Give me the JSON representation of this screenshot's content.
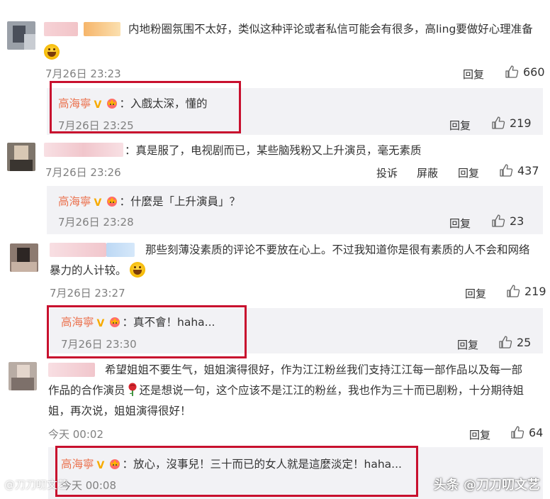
{
  "colors": {
    "reply_author": "#eb7350",
    "highlight_box": "#c8102e",
    "reply_background": "#f2f2f5",
    "timestamp": "#808080"
  },
  "comments": [
    {
      "text_line1": "内地粉圈氛围不太好，类似这种评论或者私信可能会有很多，高ling要做好心理准备",
      "timestamp": "7月26日 23:23",
      "reply_label": "回复",
      "likes": "660",
      "reply": {
        "author": "高海寧",
        "separator": "：",
        "text": "入戲太深，懂的",
        "timestamp": "7月26日 23:25",
        "reply_label": "回复",
        "likes": "219"
      }
    },
    {
      "text_line1": "：真是服了，电视剧而已，某些脑残粉又上升演员，毫无素质",
      "timestamp": "7月26日 23:26",
      "report_label": "投诉",
      "block_label": "屏蔽",
      "reply_label": "回复",
      "likes": "437",
      "reply": {
        "author": "高海寧",
        "separator": "：",
        "text": "什麼是「上升演員」？",
        "timestamp": "7月26日 23:28",
        "reply_label": "回复",
        "likes": "23"
      }
    },
    {
      "text_line1": "那些刻薄没素质的评论不要放在心上。不过我知道你是很有素质的人不会和网络",
      "text_line2": "暴力的人计较。",
      "timestamp": "7月26日 23:27",
      "reply_label": "回复",
      "likes": "219",
      "reply": {
        "author": "高海寧",
        "separator": "：",
        "text": "真不會！haha...",
        "timestamp": "7月26日 23:30",
        "reply_label": "回复",
        "likes": "25"
      }
    },
    {
      "text_line1": "希望姐姐不要生气，姐姐演得很好，作为江江粉丝我们支持江江每一部作品以及每一部",
      "text_line2a": "作品的合作演员",
      "text_line2b": "还是想说一句，这个应该不是江江的粉丝，我也作为三十而已剧粉，十分期待姐",
      "text_line3": "姐，再次说，姐姐演得很好！",
      "timestamp": "今天 00:02",
      "reply_label": "回复",
      "likes": "64",
      "reply": {
        "author": "高海寧",
        "separator": "：",
        "text": "放心，沒事兒！三十而已的女人就是這麼淡定！haha...",
        "timestamp": "今天 00:08"
      }
    }
  ],
  "watermark_right": "头条 @刀刀叨文艺",
  "watermark_left": "@刀刀叨文艺"
}
